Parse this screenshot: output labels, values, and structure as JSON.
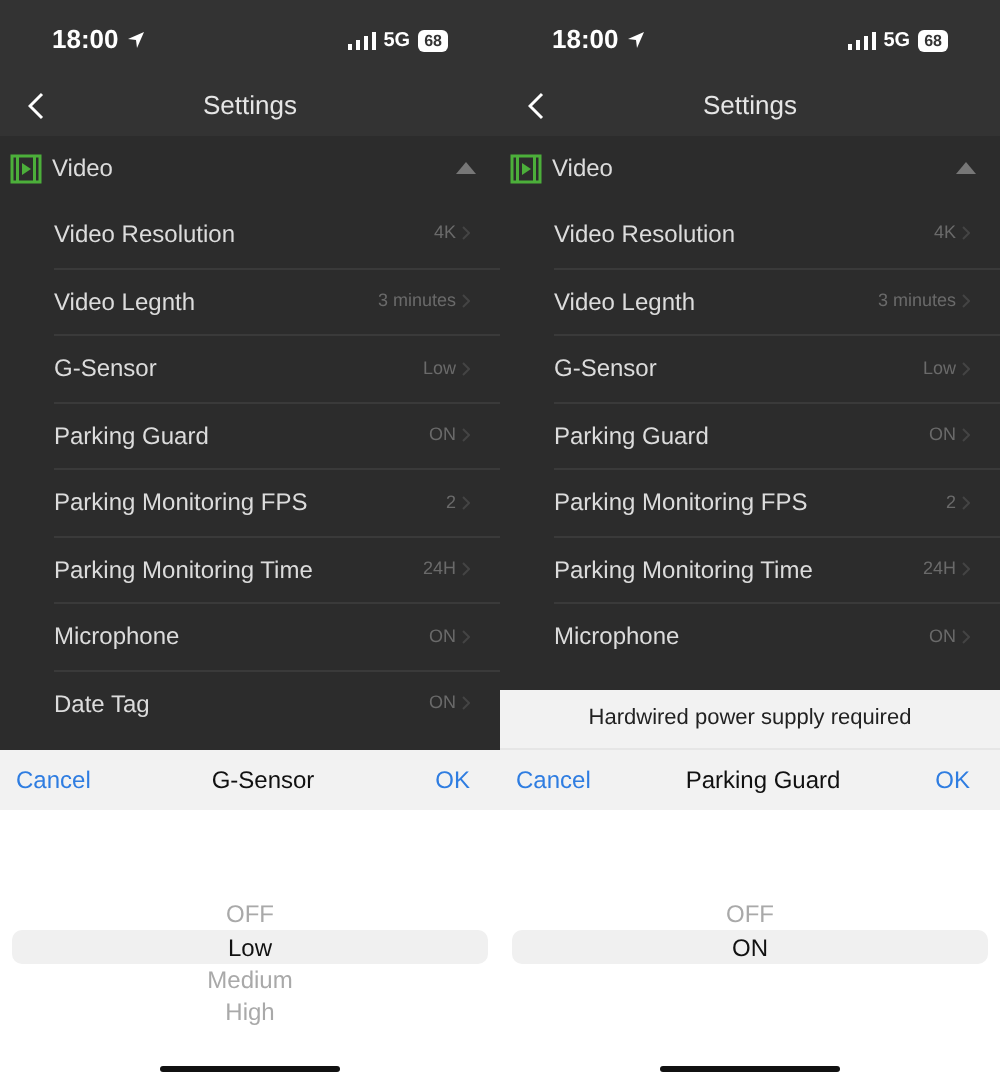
{
  "screens": [
    {
      "status": {
        "time": "18:00",
        "network": "5G",
        "battery": "68"
      },
      "title": "Settings",
      "section": {
        "label": "Video",
        "expanded": true
      },
      "rows": [
        {
          "label": "Video Resolution",
          "value": "4K"
        },
        {
          "label": "Video Legnth",
          "value": "3 minutes"
        },
        {
          "label": "G-Sensor",
          "value": "Low"
        },
        {
          "label": "Parking Guard",
          "value": "ON"
        },
        {
          "label": "Parking Monitoring FPS",
          "value": "2"
        },
        {
          "label": "Parking Monitoring Time",
          "value": "24H"
        },
        {
          "label": "Microphone",
          "value": "ON"
        },
        {
          "label": "Date Tag",
          "value": "ON"
        }
      ],
      "sheet": {
        "cancel": "Cancel",
        "title": "G-Sensor",
        "ok": "OK",
        "options": [
          {
            "label": "OFF",
            "selected": false
          },
          {
            "label": "Low",
            "selected": true
          },
          {
            "label": "Medium",
            "selected": false
          },
          {
            "label": "High",
            "selected": false
          }
        ]
      }
    },
    {
      "status": {
        "time": "18:00",
        "network": "5G",
        "battery": "68"
      },
      "title": "Settings",
      "section": {
        "label": "Video",
        "expanded": true
      },
      "rows": [
        {
          "label": "Video Resolution",
          "value": "4K"
        },
        {
          "label": "Video Legnth",
          "value": "3 minutes"
        },
        {
          "label": "G-Sensor",
          "value": "Low"
        },
        {
          "label": "Parking Guard",
          "value": "ON"
        },
        {
          "label": "Parking Monitoring FPS",
          "value": "2"
        },
        {
          "label": "Parking Monitoring Time",
          "value": "24H"
        },
        {
          "label": "Microphone",
          "value": "ON"
        }
      ],
      "sheet": {
        "note": "Hardwired power supply required",
        "cancel": "Cancel",
        "title": "Parking Guard",
        "ok": "OK",
        "options": [
          {
            "label": "OFF",
            "selected": false
          },
          {
            "label": "ON",
            "selected": true
          }
        ]
      }
    }
  ]
}
